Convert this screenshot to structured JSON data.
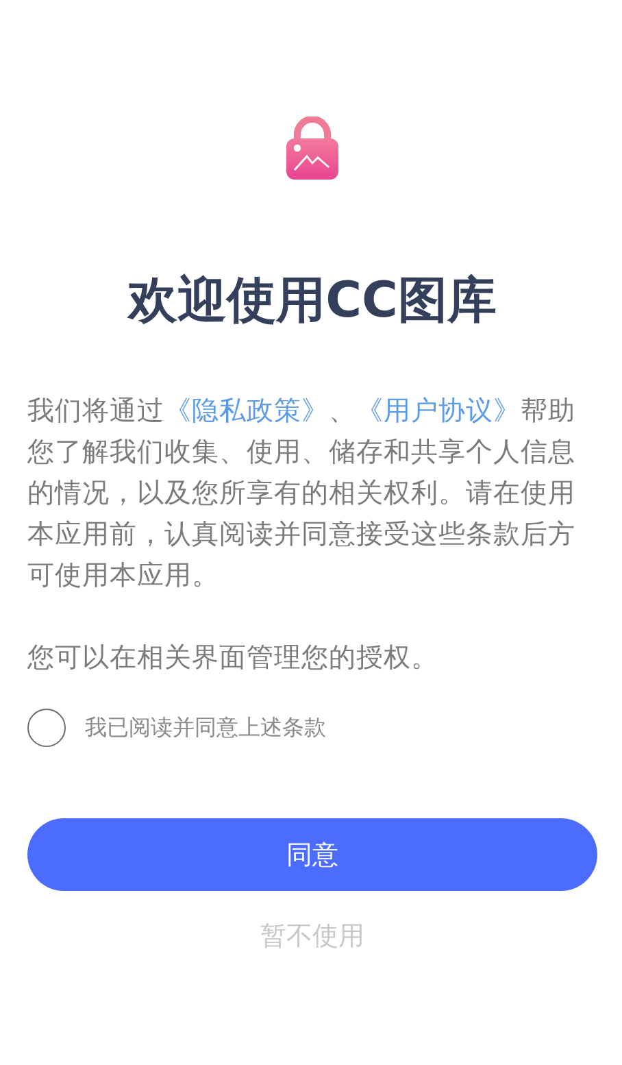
{
  "title": "欢迎使用CC图库",
  "intro": [
    {
      "kind": "text",
      "text": "我们将通过"
    },
    {
      "kind": "link",
      "text": "《隐私政策》"
    },
    {
      "kind": "text",
      "text": "、"
    },
    {
      "kind": "link",
      "text": "《用户协议》"
    },
    {
      "kind": "text",
      "text": "帮助您了解我们收集、使用、储存和共享个人信息的情况，以及您所享有的相关权利。请在使用本应用前，认真阅读并同意接受这些条款后方可使用本应用。"
    }
  ],
  "note": "您可以在相关界面管理您的授权。",
  "consent": {
    "label": "我已阅读并同意上述条款",
    "checked": false
  },
  "buttons": [
    {
      "kind": "primary",
      "label": "同意"
    },
    {
      "kind": "secondary",
      "label": "暂不使用"
    }
  ]
}
